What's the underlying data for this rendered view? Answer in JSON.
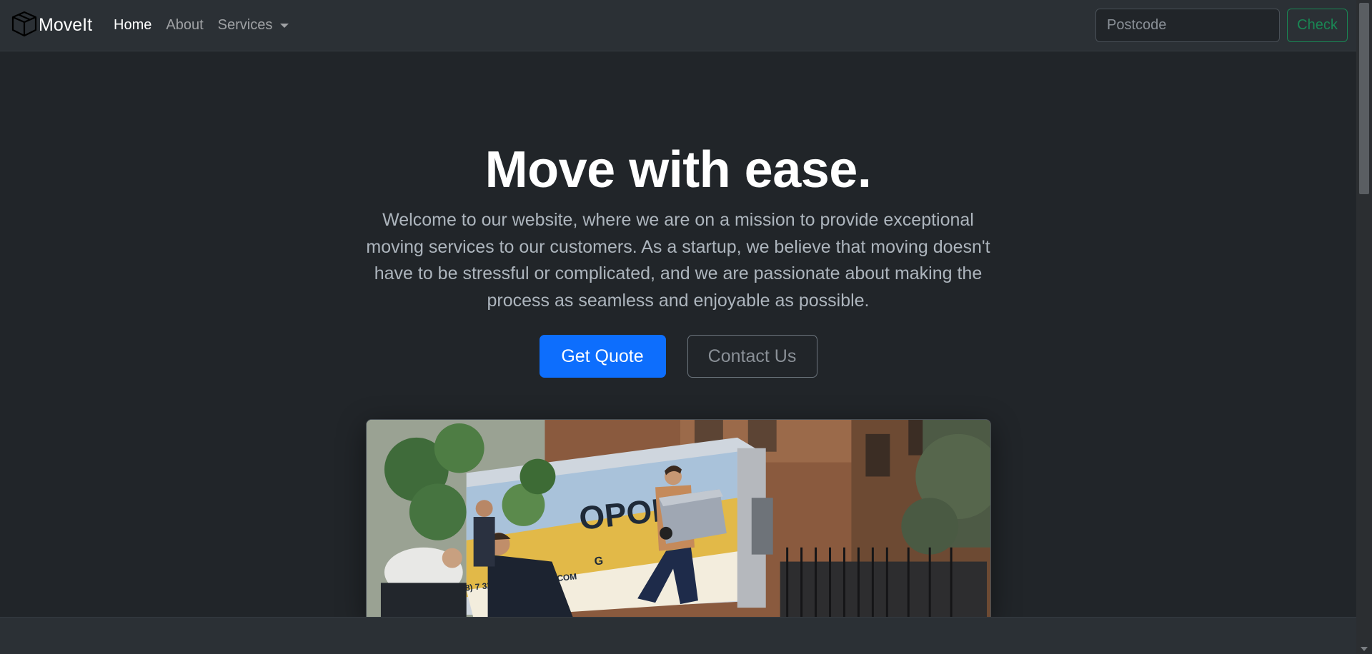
{
  "navbar": {
    "brand": "MoveIt",
    "brand_icon": "box-icon",
    "links": [
      {
        "label": "Home",
        "active": true
      },
      {
        "label": "About",
        "active": false
      },
      {
        "label": "Services",
        "active": false,
        "dropdown": true
      }
    ],
    "postcode_placeholder": "Postcode",
    "check_label": "Check"
  },
  "hero": {
    "title": "Move with ease.",
    "description": "Welcome to our website, where we are on a mission to provide exceptional moving services to our customers. As a startup, we believe that moving doesn't have to be stressful or complicated, and we are passionate about making the process as seamless and enjoyable as possible.",
    "primary_button": "Get Quote",
    "secondary_button": "Contact Us"
  },
  "truck": {
    "brand_fragment": "OPOLIS",
    "brand_sub": "G",
    "contact_text": "18) 7  320 • MO    MOVING.COM"
  },
  "colors": {
    "primary": "#0d6efd",
    "success": "#198754",
    "background": "#212529",
    "navbar": "#2b3035"
  }
}
